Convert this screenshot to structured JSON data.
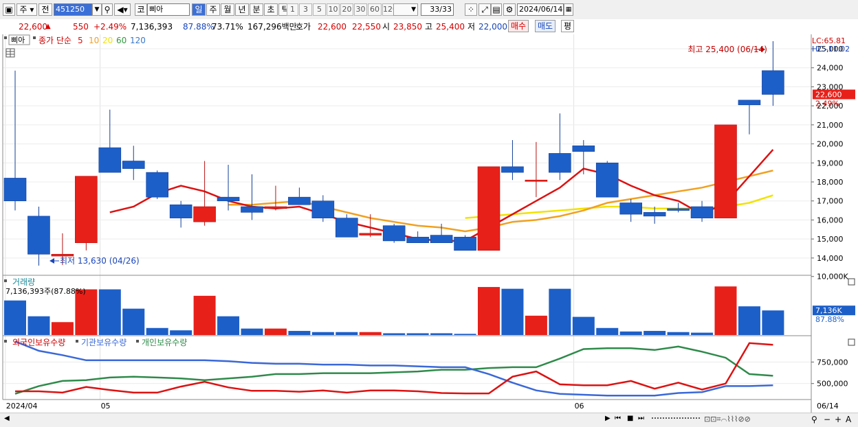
{
  "toolbar": {
    "period_type": "주",
    "prev_label": "전",
    "code": "451250",
    "market": "코",
    "name": "삐아",
    "tabs": [
      "일",
      "주",
      "월",
      "년",
      "분",
      "초",
      "틱"
    ],
    "active_tab": 0,
    "periods": [
      "1",
      "3",
      "5",
      "10",
      "20",
      "30",
      "60",
      "120"
    ],
    "count": "33/33",
    "date": "2024/06/14"
  },
  "quote": {
    "price": "22,600",
    "arrow": "▲",
    "change": "550",
    "change_pct": "+2.49%",
    "volume": "7,136,393",
    "vol_ratio": "87.88%",
    "turnover": "73.71%",
    "amount": "167,296백만",
    "bid_label": "호가",
    "ask": "22,600",
    "bid": "22,550",
    "open_label": "시",
    "open": "23,850",
    "high_label": "고",
    "high": "25,400",
    "low_label": "저",
    "low": "22,000",
    "buy_label": "매수",
    "sell_label": "매도",
    "eval_label": "평"
  },
  "price_panel": {
    "stock_tag": "삐아",
    "ma_label": "종가 단순",
    "ma_periods": [
      "5",
      "10",
      "20",
      "60",
      "120"
    ],
    "ma_colors": [
      "#dd1111",
      "#f0a020",
      "#f2e200",
      "#2e9a3e",
      "#3a78c8"
    ],
    "lc": "LC:65.81",
    "hc": "HC:-11.02",
    "high_note": "최고 25,400 (06/14)",
    "low_note": "최저 13,630 (04/26)",
    "last_price_tag": "22,600",
    "last_pct_tag": "2.49%"
  },
  "volume_panel": {
    "title": "거래량",
    "info": "7,136,393주(87.88%)",
    "last_tag": "7,136K",
    "last_pct": "87.88%"
  },
  "holdings_panel": {
    "labels": [
      "외국인보유수량",
      "기관보유수량",
      "개인보유수량"
    ],
    "colors": [
      "#dd1111",
      "#3a68d8",
      "#2e8a4a"
    ]
  },
  "xaxis": {
    "labels": [
      {
        "i": 0,
        "t": "2024/04"
      },
      {
        "i": 4,
        "t": "05"
      },
      {
        "i": 24,
        "t": "06"
      }
    ],
    "end_label": "06/14"
  },
  "chart_data": {
    "type": "candlestick",
    "price_axis": {
      "ticks": [
        14000,
        15000,
        16000,
        17000,
        18000,
        19000,
        20000,
        21000,
        22000,
        23000,
        24000,
        25000
      ]
    },
    "candles": [
      {
        "o": 18200,
        "h": 23850,
        "l": 16500,
        "c": 17000
      },
      {
        "o": 16200,
        "h": 16700,
        "l": 13600,
        "c": 14200
      },
      {
        "o": 14100,
        "h": 15300,
        "l": 13630,
        "c": 14200
      },
      {
        "o": 14800,
        "h": 18300,
        "l": 14400,
        "c": 18300
      },
      {
        "o": 19800,
        "h": 21800,
        "l": 18500,
        "c": 18500
      },
      {
        "o": 19100,
        "h": 19900,
        "l": 18100,
        "c": 18700
      },
      {
        "o": 18500,
        "h": 18600,
        "l": 17100,
        "c": 17200
      },
      {
        "o": 16800,
        "h": 17000,
        "l": 15600,
        "c": 16100
      },
      {
        "o": 15900,
        "h": 19100,
        "l": 15700,
        "c": 16700
      },
      {
        "o": 17200,
        "h": 18900,
        "l": 16500,
        "c": 17000
      },
      {
        "o": 16700,
        "h": 18400,
        "l": 16000,
        "c": 16400
      },
      {
        "o": 16600,
        "h": 17800,
        "l": 16500,
        "c": 16700
      },
      {
        "o": 17200,
        "h": 17700,
        "l": 16800,
        "c": 16800
      },
      {
        "o": 17000,
        "h": 17300,
        "l": 15900,
        "c": 16100
      },
      {
        "o": 16100,
        "h": 16300,
        "l": 15100,
        "c": 15100
      },
      {
        "o": 15200,
        "h": 16300,
        "l": 15100,
        "c": 15300
      },
      {
        "o": 15700,
        "h": 15800,
        "l": 14800,
        "c": 14900
      },
      {
        "o": 15100,
        "h": 15400,
        "l": 14800,
        "c": 14800
      },
      {
        "o": 15200,
        "h": 15800,
        "l": 14900,
        "c": 14800
      },
      {
        "o": 15100,
        "h": 15200,
        "l": 14400,
        "c": 14400
      },
      {
        "o": 14400,
        "h": 18800,
        "l": 14400,
        "c": 18800
      },
      {
        "o": 18800,
        "h": 20200,
        "l": 18100,
        "c": 18500
      },
      {
        "o": 18100,
        "h": 20100,
        "l": 17200,
        "c": 18100
      },
      {
        "o": 19500,
        "h": 21600,
        "l": 18100,
        "c": 18500
      },
      {
        "o": 19900,
        "h": 20200,
        "l": 18400,
        "c": 19600
      },
      {
        "o": 19000,
        "h": 19100,
        "l": 17200,
        "c": 17200
      },
      {
        "o": 16900,
        "h": 17100,
        "l": 15900,
        "c": 16300
      },
      {
        "o": 16400,
        "h": 16700,
        "l": 15800,
        "c": 16200
      },
      {
        "o": 16600,
        "h": 16900,
        "l": 16400,
        "c": 16500
      },
      {
        "o": 16700,
        "h": 17000,
        "l": 15900,
        "c": 16100
      },
      {
        "o": 16100,
        "h": 21000,
        "l": 16100,
        "c": 21000
      },
      {
        "o": 22300,
        "h": 22300,
        "l": 20500,
        "c": 22050
      },
      {
        "o": 23850,
        "h": 25400,
        "l": 22000,
        "c": 22600
      }
    ],
    "ma5": [
      null,
      null,
      null,
      null,
      16400,
      16700,
      17400,
      17800,
      17500,
      17000,
      16700,
      16600,
      16700,
      16300,
      15900,
      15600,
      15300,
      15000,
      14900,
      14900,
      15600,
      16300,
      17000,
      17700,
      18700,
      18400,
      17800,
      17300,
      17000,
      16300,
      16900,
      18300,
      19700
    ],
    "ma10": [
      null,
      null,
      null,
      null,
      null,
      null,
      null,
      null,
      null,
      16800,
      16800,
      16900,
      17000,
      16700,
      16400,
      16100,
      15900,
      15700,
      15600,
      15400,
      15600,
      15900,
      16000,
      16200,
      16500,
      16900,
      17100,
      17300,
      17500,
      17700,
      18000,
      18300,
      18600
    ],
    "ma20": [
      null,
      null,
      null,
      null,
      null,
      null,
      null,
      null,
      null,
      null,
      null,
      null,
      null,
      null,
      null,
      null,
      null,
      null,
      null,
      16100,
      16200,
      16300,
      16400,
      16500,
      16600,
      16700,
      16700,
      16600,
      16600,
      16600,
      16700,
      16900,
      17300
    ],
    "volume": [
      5900000,
      3200000,
      2200000,
      7800000,
      7800000,
      4500000,
      1200000,
      800000,
      6700000,
      3200000,
      1100000,
      1100000,
      700000,
      500000,
      500000,
      500000,
      300000,
      300000,
      300000,
      200000,
      8200000,
      7900000,
      3300000,
      7900000,
      3100000,
      1200000,
      600000,
      700000,
      500000,
      400000,
      8300000,
      4900000,
      4200000
    ],
    "volume_axis": {
      "ticks": [
        10000000
      ],
      "tick_labels": [
        "10,000K"
      ]
    },
    "foreign": [
      410000,
      410000,
      395000,
      460000,
      425000,
      395000,
      395000,
      465000,
      520000,
      455000,
      415000,
      415000,
      405000,
      420000,
      395000,
      420000,
      420000,
      410000,
      390000,
      385000,
      385000,
      580000,
      640000,
      490000,
      480000,
      480000,
      530000,
      440000,
      510000,
      430000,
      500000,
      970000,
      950000
    ],
    "institution": [
      990000,
      880000,
      830000,
      770000,
      770000,
      770000,
      770000,
      770000,
      770000,
      760000,
      740000,
      730000,
      730000,
      720000,
      720000,
      710000,
      710000,
      700000,
      690000,
      690000,
      610000,
      510000,
      420000,
      380000,
      370000,
      360000,
      360000,
      360000,
      390000,
      400000,
      470000,
      470000,
      480000
    ],
    "individual": [
      380000,
      470000,
      530000,
      540000,
      570000,
      580000,
      570000,
      560000,
      540000,
      560000,
      580000,
      610000,
      610000,
      620000,
      620000,
      620000,
      630000,
      640000,
      660000,
      660000,
      680000,
      690000,
      690000,
      790000,
      900000,
      910000,
      910000,
      890000,
      930000,
      870000,
      800000,
      610000,
      590000
    ],
    "holdings_axis": {
      "ticks": [
        500000,
        750000
      ],
      "tick_labels": [
        "500,000",
        "750,000"
      ]
    }
  }
}
